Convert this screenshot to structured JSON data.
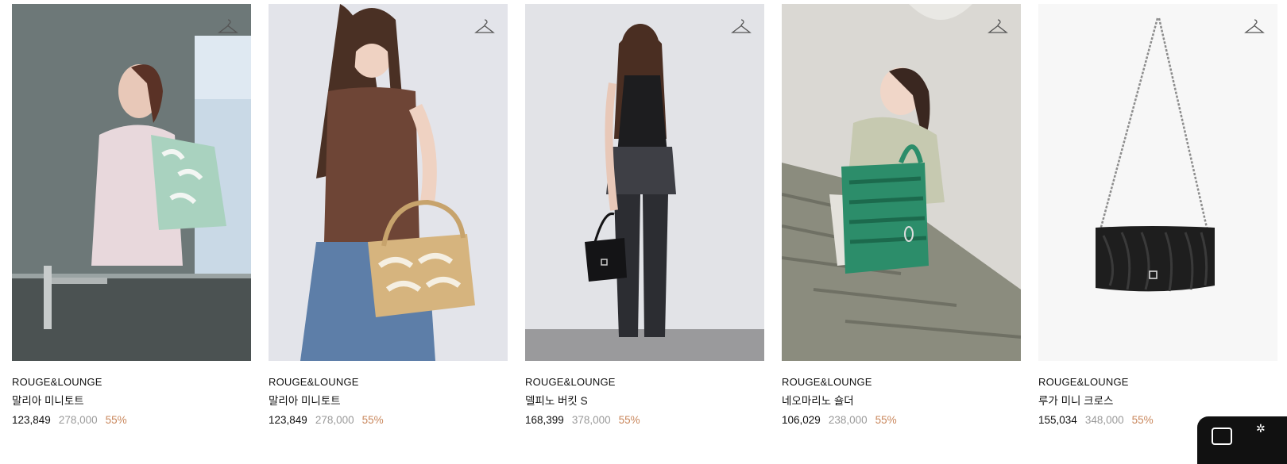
{
  "products": [
    {
      "brand": "ROUGE&LOUNGE",
      "name": "말리아 미니토트",
      "price": "123,849",
      "original_price": "278,000",
      "discount": "55%",
      "image": "model-with-mint-chain-pattern-tote"
    },
    {
      "brand": "ROUGE&LOUNGE",
      "name": "말리아 미니토트",
      "price": "123,849",
      "original_price": "278,000",
      "discount": "55%",
      "image": "model-with-beige-chain-pattern-tote"
    },
    {
      "brand": "ROUGE&LOUNGE",
      "name": "델피노 버킷 S",
      "price": "168,399",
      "original_price": "378,000",
      "discount": "55%",
      "image": "model-back-view-black-bucket-bag"
    },
    {
      "brand": "ROUGE&LOUNGE",
      "name": "네오마리노 숄더",
      "price": "106,029",
      "original_price": "238,000",
      "discount": "55%",
      "image": "model-on-stairs-green-shoulder-bag"
    },
    {
      "brand": "ROUGE&LOUNGE",
      "name": "루가 미니 크로스",
      "price": "155,034",
      "original_price": "348,000",
      "discount": "55%",
      "image": "black-pleated-chain-cross-bag"
    }
  ],
  "icons": {
    "wishlist": "hanger-icon"
  },
  "colors": {
    "discount": "#c9875c",
    "original_price": "#9a9a9a",
    "text": "#111111"
  }
}
